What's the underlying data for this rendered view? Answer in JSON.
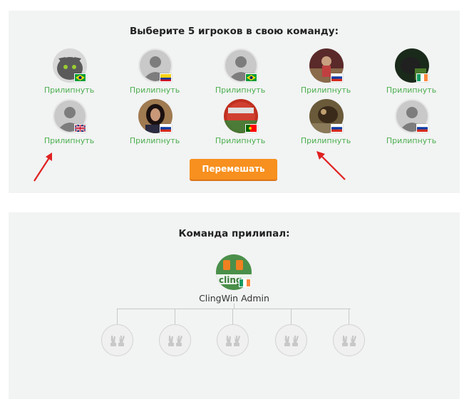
{
  "select_panel": {
    "title": "Выберите 5 игроков в свою команду:",
    "stick_label": "Прилипнуть",
    "players": [
      {
        "avatar": "kitten-photo",
        "flag": "brazil"
      },
      {
        "avatar": "default-avatar",
        "flag": "colombia"
      },
      {
        "avatar": "default-avatar",
        "flag": "brazil"
      },
      {
        "avatar": "person-photo",
        "flag": "russia"
      },
      {
        "avatar": "animal-photo",
        "flag": "ireland"
      },
      {
        "avatar": "default-avatar",
        "flag": "uk"
      },
      {
        "avatar": "woman-photo",
        "flag": "russia"
      },
      {
        "avatar": "portugal-ball",
        "flag": "portugal"
      },
      {
        "avatar": "bird-photo",
        "flag": "russia"
      },
      {
        "avatar": "default-avatar",
        "flag": "russia"
      }
    ],
    "shuffle_label": "Перемешать"
  },
  "team_panel": {
    "title": "Команда прилипал:",
    "admin_name": "ClingWin Admin",
    "admin_flag": "ireland",
    "empty_slots": 5
  },
  "colors": {
    "panel_bg": "#f2f3f3",
    "link_green": "#4caf50",
    "button_orange": "#f7901e",
    "arrow_red": "#e02020"
  }
}
